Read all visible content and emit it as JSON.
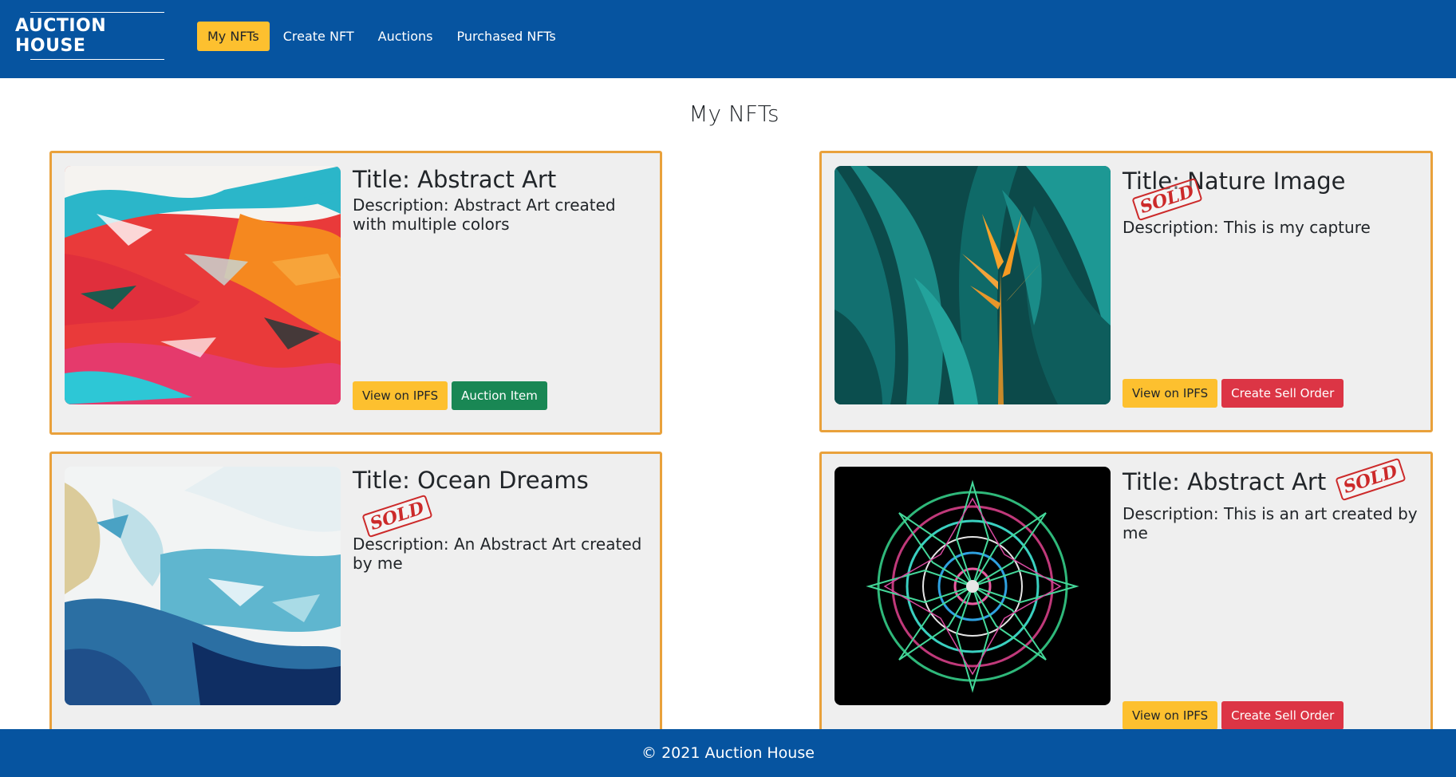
{
  "navbar": {
    "brand": "AUCTION HOUSE",
    "links": [
      {
        "label": "My NFTs"
      },
      {
        "label": "Create NFT"
      },
      {
        "label": "Auctions"
      },
      {
        "label": "Purchased NFTs"
      }
    ]
  },
  "page": {
    "title": "My NFTs"
  },
  "cards": [
    {
      "title": "Title: Abstract Art",
      "description": "Description: Abstract Art created with multiple colors",
      "sold": "",
      "buttons": [
        "View on IPFS",
        "Auction Item"
      ],
      "image": "abstract-paint-image"
    },
    {
      "title": "Title: Nature Image",
      "description": "Description: This is my capture",
      "sold": "SOLD",
      "buttons": [
        "View on IPFS",
        "Create Sell Order"
      ],
      "image": "tropical-leaves-image"
    },
    {
      "title": "Title: Ocean Dreams",
      "description": "Description: An Abstract Art created by me",
      "sold": "SOLD",
      "buttons": [],
      "image": "ocean-abstract-image"
    },
    {
      "title": "Title: Abstract Art",
      "description": "Description: This is an art created by me",
      "sold": "SOLD",
      "buttons": [
        "View on IPFS",
        "Create Sell Order"
      ],
      "image": "mandala-image"
    }
  ],
  "footer": {
    "text": "© 2021 Auction House"
  },
  "colors": {
    "navbar": "#0654a0",
    "accent_yellow": "#fdc02f",
    "card_border": "#e9a13b",
    "card_bg": "#efefef",
    "green": "#198754",
    "red": "#dc3545"
  }
}
